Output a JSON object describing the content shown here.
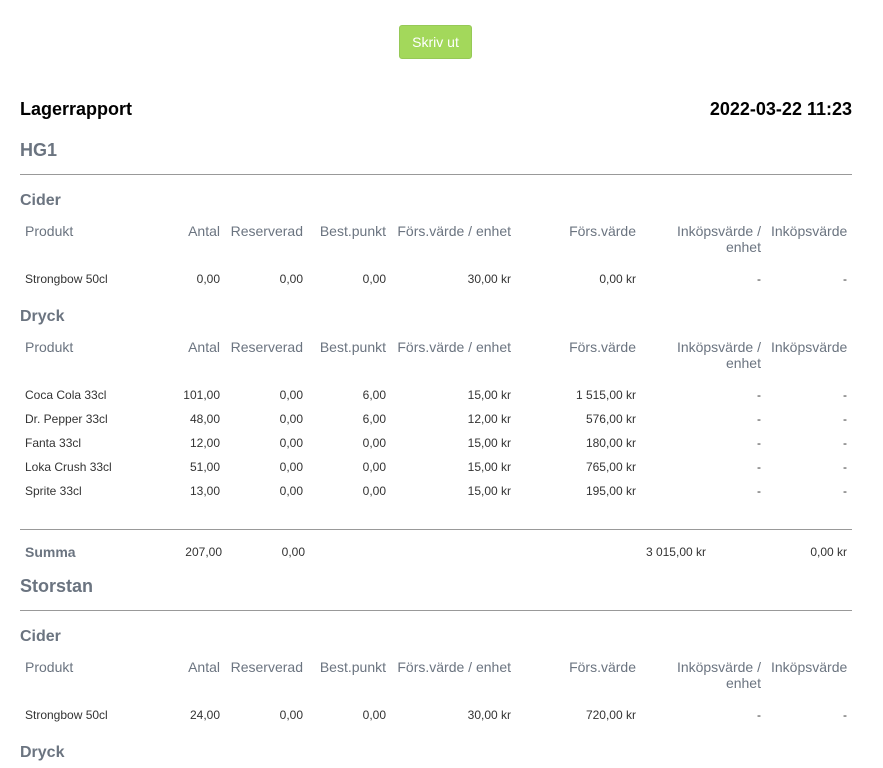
{
  "print_button_label": "Skriv ut",
  "report": {
    "title": "Lagerrapport",
    "datetime": "2022-03-22 11:23"
  },
  "columns": [
    "Produkt",
    "Antal",
    "Reserverad",
    "Best.punkt",
    "Förs.värde / enhet",
    "Förs.värde",
    "Inköpsvärde / enhet",
    "Inköpsvärde"
  ],
  "locations": [
    {
      "name": "HG1",
      "categories": [
        {
          "name": "Cider",
          "rows": [
            [
              "Strongbow 50cl",
              "0,00",
              "0,00",
              "0,00",
              "30,00 kr",
              "0,00 kr",
              "-",
              "-"
            ]
          ]
        },
        {
          "name": "Dryck",
          "rows": [
            [
              "Coca Cola 33cl",
              "101,00",
              "0,00",
              "6,00",
              "15,00 kr",
              "1 515,00 kr",
              "-",
              "-"
            ],
            [
              "Dr. Pepper 33cl",
              "48,00",
              "0,00",
              "6,00",
              "12,00 kr",
              "576,00 kr",
              "-",
              "-"
            ],
            [
              "Fanta 33cl",
              "12,00",
              "0,00",
              "0,00",
              "15,00 kr",
              "180,00 kr",
              "-",
              "-"
            ],
            [
              "Loka Crush 33cl",
              "51,00",
              "0,00",
              "0,00",
              "15,00 kr",
              "765,00 kr",
              "-",
              "-"
            ],
            [
              "Sprite 33cl",
              "13,00",
              "0,00",
              "0,00",
              "15,00 kr",
              "195,00 kr",
              "-",
              "-"
            ]
          ]
        }
      ],
      "summary": {
        "label": "Summa",
        "antal": "207,00",
        "reserverad": "0,00",
        "fors_varde": "3 015,00 kr",
        "inkops_varde": "0,00 kr"
      }
    },
    {
      "name": "Storstan",
      "categories": [
        {
          "name": "Cider",
          "rows": [
            [
              "Strongbow 50cl",
              "24,00",
              "0,00",
              "0,00",
              "30,00 kr",
              "720,00 kr",
              "-",
              "-"
            ]
          ]
        },
        {
          "name": "Dryck",
          "rows": []
        }
      ]
    }
  ]
}
